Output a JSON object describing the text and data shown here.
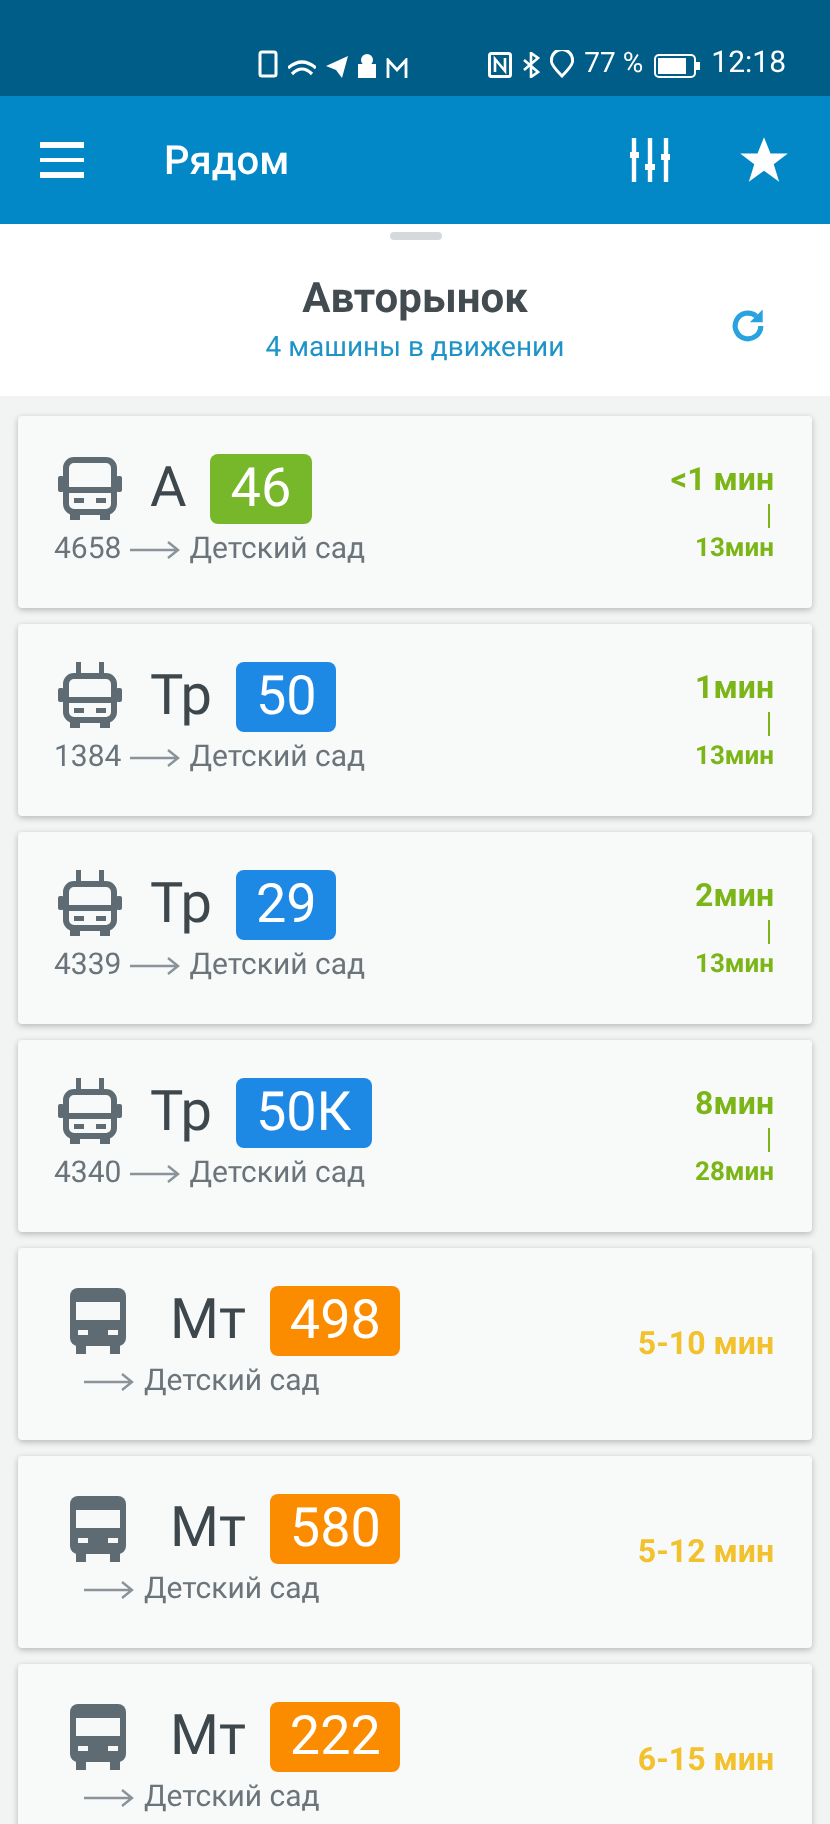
{
  "status_bar": {
    "battery": "77 %",
    "time": "12:18"
  },
  "app_bar": {
    "title": "Рядом"
  },
  "stop": {
    "name": "Авторынок",
    "subtitle": "4 машины в движении"
  },
  "arrivals": [
    {
      "kind": "bus",
      "type": "А",
      "route": "46",
      "color": "#76b82a",
      "vehicle": "4658",
      "destination": "Детский сад",
      "time": "<1 мин",
      "live": true,
      "next": "13мин"
    },
    {
      "kind": "trolleybus",
      "type": "Тр",
      "route": "50",
      "color": "#1e88e5",
      "vehicle": "1384",
      "destination": "Детский сад",
      "time": "1мин",
      "live": true,
      "next": "13мин"
    },
    {
      "kind": "trolleybus",
      "type": "Тр",
      "route": "29",
      "color": "#1e88e5",
      "vehicle": "4339",
      "destination": "Детский сад",
      "time": "2мин",
      "live": true,
      "next": "13мин"
    },
    {
      "kind": "trolleybus",
      "type": "Тр",
      "route": "50К",
      "color": "#1e88e5",
      "vehicle": "4340",
      "destination": "Детский сад",
      "time": "8мин",
      "live": true,
      "next": "28мин"
    },
    {
      "kind": "minibus",
      "type": "Мт",
      "route": "498",
      "color": "#fb8c00",
      "destination": "Детский сад",
      "time": "5-10 мин",
      "live": false
    },
    {
      "kind": "minibus",
      "type": "Мт",
      "route": "580",
      "color": "#fb8c00",
      "destination": "Детский сад",
      "time": "5-12 мин",
      "live": false
    },
    {
      "kind": "minibus",
      "type": "Мт",
      "route": "222",
      "color": "#fb8c00",
      "destination": "Детский сад",
      "time": "6-15 мин",
      "live": false
    }
  ]
}
